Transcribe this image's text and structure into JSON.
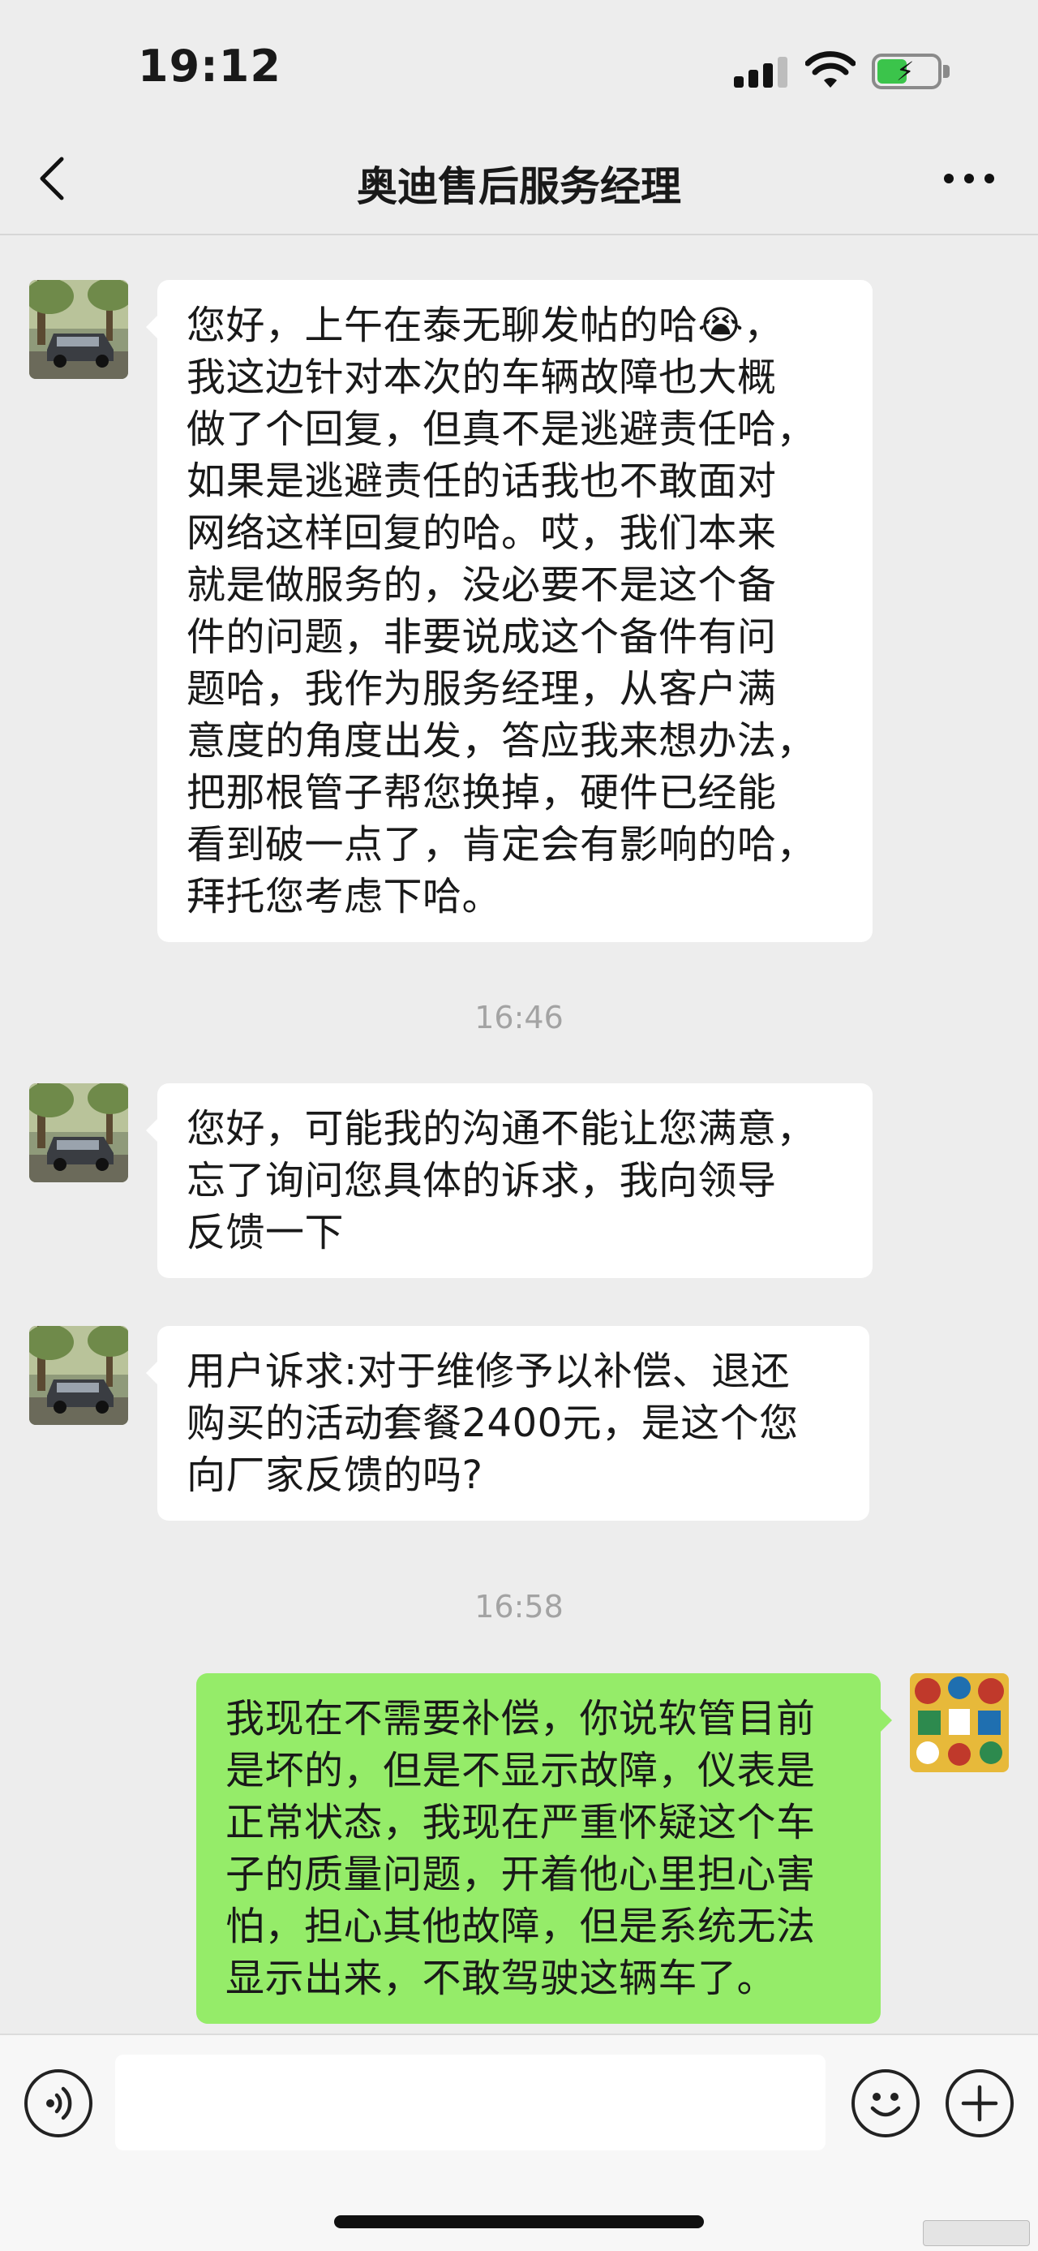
{
  "status_bar": {
    "time": "19:12"
  },
  "nav": {
    "title": "奥迪售后服务经理"
  },
  "messages": [
    {
      "side": "left",
      "text": "您好，上午在泰无聊发帖的哈😭，\n我这边针对本次的车辆故障也大概\n做了个回复，但真不是逃避责任哈，\n如果是逃避责任的话我也不敢面对\n网络这样回复的哈。哎，我们本来\n就是做服务的，没必要不是这个备\n件的问题，非要说成这个备件有问\n题哈，我作为服务经理，从客户满\n意度的角度出发，答应我来想办法，\n把那根管子帮您换掉，硬件已经能\n看到破一点了，肯定会有影响的哈，\n拜托您考虑下哈。"
    },
    {
      "side": "left",
      "text": "您好，可能我的沟通不能让您满意，\n忘了询问您具体的诉求，我向领导\n反馈一下"
    },
    {
      "side": "left",
      "text": "用户诉求:对于维修予以补偿、退还\n购买的活动套餐2400元，是这个您\n向厂家反馈的吗?"
    },
    {
      "side": "right",
      "text": "我现在不需要补偿，你说软管目前\n是坏的，但是不显示故障，仪表是\n正常状态，我现在严重怀疑这个车\n子的质量问题，开着他心里担心害\n怕，担心其他故障，但是系统无法\n显示出来，不敢驾驶这辆车了。"
    }
  ],
  "timestamps": [
    "16:46",
    "16:58"
  ],
  "icons": {
    "back": "chevron-left-icon",
    "more": "more-dots-icon",
    "voice": "voice-icon",
    "emoji": "emoji-icon",
    "plus": "plus-icon"
  },
  "colors": {
    "background": "#ededed",
    "incoming_bubble": "#ffffff",
    "outgoing_bubble": "#95ec69",
    "timestamp": "#a3a3a3"
  }
}
